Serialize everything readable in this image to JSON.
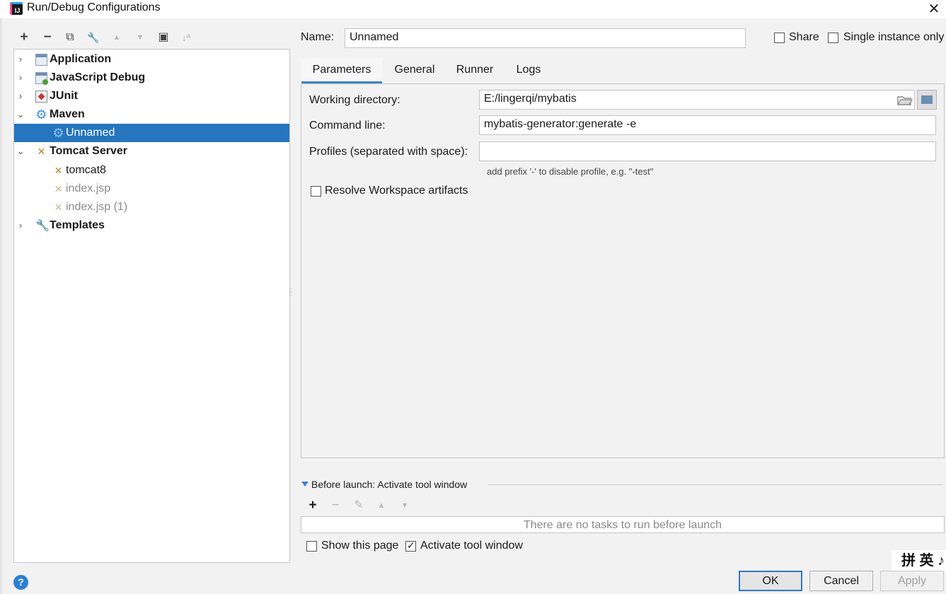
{
  "window": {
    "title": "Run/Debug Configurations",
    "close_glyph": "✕"
  },
  "toolbar": {
    "add": "+",
    "remove": "−",
    "copy": "⧉",
    "edit_defaults": "🔧",
    "move_up": "▲",
    "move_down": "▼",
    "new_folder": "▣",
    "sort": "↓ª"
  },
  "tree": {
    "nodes": [
      {
        "label": "Application",
        "expander": "›",
        "icon": "application-icon"
      },
      {
        "label": "JavaScript Debug",
        "expander": "›",
        "icon": "javascript-debug-icon"
      },
      {
        "label": "JUnit",
        "expander": "›",
        "icon": "junit-icon"
      },
      {
        "label": "Maven",
        "expander": "⌄",
        "icon": "maven-gear-icon"
      },
      {
        "label": "Unnamed",
        "icon": "maven-gear-icon",
        "selected": true
      },
      {
        "label": "Tomcat Server",
        "expander": "⌄",
        "icon": "tomcat-icon"
      },
      {
        "label": "tomcat8",
        "icon": "tomcat-icon"
      },
      {
        "label": "index.jsp",
        "icon": "tomcat-icon"
      },
      {
        "label": "index.jsp (1)",
        "icon": "tomcat-icon"
      },
      {
        "label": "Templates",
        "expander": "›",
        "icon": "wrench-icon"
      }
    ]
  },
  "config": {
    "name_label": "Name:",
    "name_value": "Unnamed",
    "share_label": "Share",
    "share_checked": false,
    "single_instance_label": "Single instance only",
    "single_instance_checked": false
  },
  "tabs": [
    "Parameters",
    "General",
    "Runner",
    "Logs"
  ],
  "active_tab": "Parameters",
  "parameters": {
    "working_dir_label": "Working directory:",
    "working_dir_value": "E:/lingerqi/mybatis",
    "command_line_label": "Command line:",
    "command_line_value": "mybatis-generator:generate -e",
    "profiles_label": "Profiles (separated with space):",
    "profiles_value": "",
    "profiles_hint": "add prefix '-' to disable profile, e.g. \"-test\"",
    "resolve_label": "Resolve Workspace artifacts",
    "resolve_checked": false
  },
  "before_launch": {
    "title": "Before launch: Activate tool window",
    "add": "+",
    "remove": "−",
    "edit": "✎",
    "up": "▲",
    "down": "▼",
    "empty_text": "There are no tasks to run before launch",
    "show_page_label": "Show this page",
    "show_page_checked": false,
    "activate_label": "Activate tool window",
    "activate_checked": true
  },
  "ime": {
    "text": "拼 英 ♪"
  },
  "buttons": {
    "help": "?",
    "ok": "OK",
    "cancel": "Cancel",
    "apply": "Apply"
  }
}
